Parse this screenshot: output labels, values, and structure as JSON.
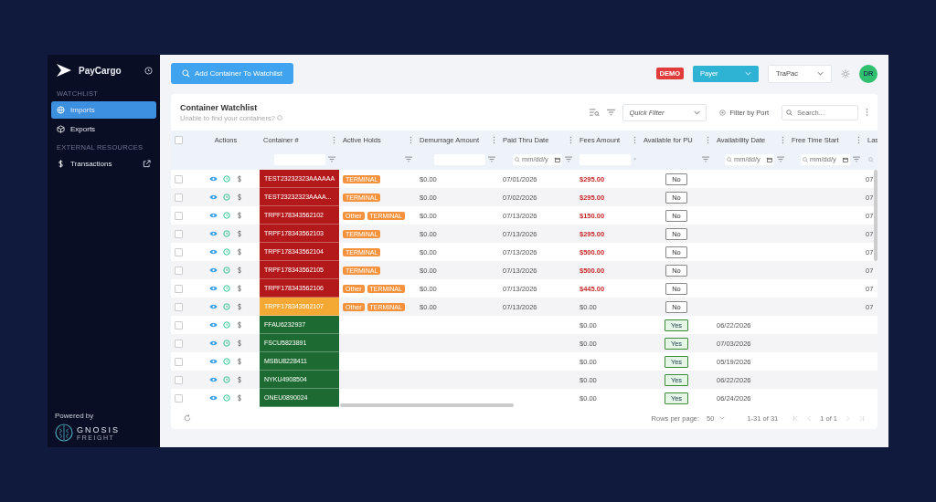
{
  "sidebar": {
    "brand": "PayCargo",
    "sections": [
      {
        "title": "WATCHLIST",
        "items": [
          {
            "label": "Imports",
            "kind": "globe",
            "selected": true,
            "external": false
          },
          {
            "label": "Exports",
            "kind": "box",
            "selected": false,
            "external": false
          }
        ]
      },
      {
        "title": "EXTERNAL RESOURCES",
        "items": [
          {
            "label": "Transactions",
            "kind": "dollar",
            "selected": false,
            "external": true
          }
        ]
      }
    ],
    "powered_by": "Powered by",
    "partner": {
      "name": "GNOSIS",
      "sub": "FREIGHT"
    }
  },
  "topbar": {
    "add_button": "Add Container To Watchlist",
    "badge": "DEMO",
    "role_select": "Payer",
    "terminal_select": "TraPac",
    "avatar": "DR"
  },
  "card": {
    "title": "Container Watchlist",
    "help": "Unable to find your containers?",
    "quick_filter": "Quick Filter",
    "port_filter": "Filter by Port",
    "search_placeholder": "Search..."
  },
  "table": {
    "all_checked": false,
    "columns": [
      {
        "label": "Actions",
        "menu": false,
        "kind": "none"
      },
      {
        "label": "Container #",
        "menu": true,
        "kind": "text"
      },
      {
        "label": "Active Holds",
        "menu": true,
        "kind": "select"
      },
      {
        "label": "Demurrage Amount",
        "menu": true,
        "kind": "text"
      },
      {
        "label": "Paid Thru Date",
        "menu": true,
        "kind": "date",
        "placeholder": "mm/dd/y"
      },
      {
        "label": "Fees Amount",
        "menu": true,
        "kind": "text"
      },
      {
        "label": "Available for PU",
        "menu": true,
        "kind": "select"
      },
      {
        "label": "Availability Date",
        "menu": true,
        "kind": "date",
        "placeholder": "mm/dd/y"
      },
      {
        "label": "Free Time Start",
        "menu": true,
        "kind": "date",
        "placeholder": "mm/dd/y"
      },
      {
        "label": "Las",
        "menu": false,
        "kind": "search"
      }
    ],
    "rows": [
      {
        "checked": false,
        "container": "TEST23232323AAAAAA",
        "color": "#b3191b",
        "holds": [
          "TERMINAL"
        ],
        "demurrage": "$0.00",
        "paid_thru": "07/01/2026",
        "fees": "$295.00",
        "fees_due": true,
        "pu": "No",
        "available": false,
        "last": "07"
      },
      {
        "checked": false,
        "container": "TEST23232323AAAA...",
        "color": "#b3191b",
        "holds": [
          "TERMINAL"
        ],
        "demurrage": "$0.00",
        "paid_thru": "07/02/2026",
        "fees": "$295.00",
        "fees_due": true,
        "pu": "No",
        "available": false,
        "last": "07"
      },
      {
        "checked": false,
        "container": "TRPF178343562102",
        "color": "#b3191b",
        "holds": [
          "Other",
          "TERMINAL"
        ],
        "demurrage": "$0.00",
        "paid_thru": "07/13/2026",
        "fees": "$150.00",
        "fees_due": true,
        "pu": "No",
        "available": false,
        "last": "07"
      },
      {
        "checked": false,
        "container": "TRPF178343562103",
        "color": "#b3191b",
        "holds": [
          "TERMINAL"
        ],
        "demurrage": "$0.00",
        "paid_thru": "07/13/2026",
        "fees": "$295.00",
        "fees_due": true,
        "pu": "No",
        "available": false,
        "last": "07"
      },
      {
        "checked": false,
        "container": "TRPF178343562104",
        "color": "#b3191b",
        "holds": [
          "TERMINAL"
        ],
        "demurrage": "$0.00",
        "paid_thru": "07/13/2026",
        "fees": "$500.00",
        "fees_due": true,
        "pu": "No",
        "available": false,
        "last": "07"
      },
      {
        "checked": false,
        "container": "TRPF178343562105",
        "color": "#b3191b",
        "holds": [
          "TERMINAL"
        ],
        "demurrage": "$0.00",
        "paid_thru": "07/13/2026",
        "fees": "$500.00",
        "fees_due": true,
        "pu": "No",
        "available": false,
        "last": "07"
      },
      {
        "checked": false,
        "container": "TRPF178343562106",
        "color": "#b3191b",
        "holds": [
          "Other",
          "TERMINAL"
        ],
        "demurrage": "$0.00",
        "paid_thru": "07/13/2026",
        "fees": "$445.00",
        "fees_due": true,
        "pu": "No",
        "available": false,
        "last": "07"
      },
      {
        "checked": false,
        "container": "TRPF178343562107",
        "color": "#f5a935",
        "holds": [
          "Other",
          "TERMINAL"
        ],
        "demurrage": "$0.00",
        "paid_thru": "07/13/2026",
        "fees": "$0.00",
        "fees_due": false,
        "pu": "No",
        "available": false,
        "last": "07"
      },
      {
        "checked": false,
        "container": "FFAU6232937",
        "color": "#1d6b32",
        "fees": "$0.00",
        "fees_due": false,
        "pu": "Yes",
        "available": true,
        "availability_date": "06/22/2026"
      },
      {
        "checked": false,
        "container": "FSCU5823891",
        "color": "#1d6b32",
        "fees": "$0.00",
        "fees_due": false,
        "pu": "Yes",
        "available": true,
        "availability_date": "07/03/2026"
      },
      {
        "checked": false,
        "container": "MSBU8228411",
        "color": "#1d6b32",
        "fees": "$0.00",
        "fees_due": false,
        "pu": "Yes",
        "available": true,
        "availability_date": "05/19/2026"
      },
      {
        "checked": false,
        "container": "NYKU4908504",
        "color": "#1d6b32",
        "fees": "$0.00",
        "fees_due": false,
        "pu": "Yes",
        "available": true,
        "availability_date": "06/22/2026"
      },
      {
        "checked": false,
        "container": "ONEU0890024",
        "color": "#1d6b32",
        "fees": "$0.00",
        "fees_due": false,
        "pu": "Yes",
        "available": true,
        "availability_date": "06/24/2026"
      }
    ],
    "footer": {
      "rows_label": "Rows per page:",
      "rows_value": "50",
      "range": "1-31 of 31",
      "page": "1 of 1"
    }
  }
}
